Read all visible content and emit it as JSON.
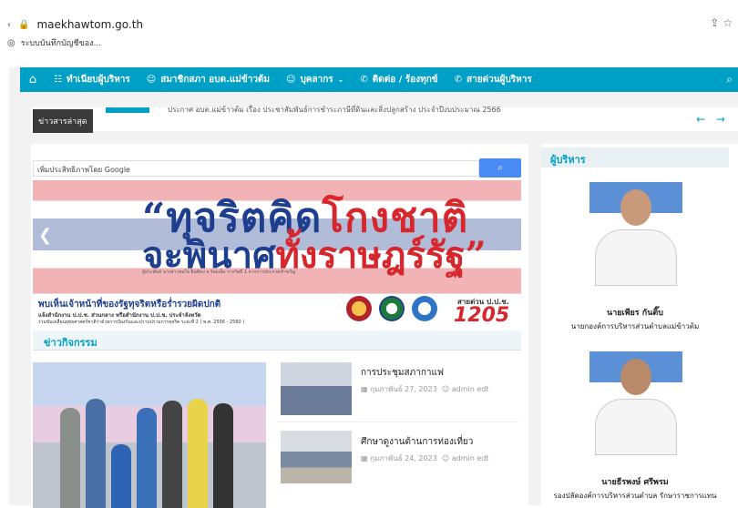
{
  "browser": {
    "url": "maekhawtom.go.th",
    "bookmark": "ระบบบันทึกบัญชีของ..."
  },
  "nav": {
    "items": [
      {
        "label": "ทำเนียบผู้บริหาร",
        "icon": "sitemap-icon"
      },
      {
        "label": "สมาชิกสภา อบต.แม่ข้าวต้ม",
        "icon": "user-icon"
      },
      {
        "label": "บุคลากร",
        "icon": "user-icon",
        "has_dropdown": true
      },
      {
        "label": "ติดต่อ / ร้องทุกข์",
        "icon": "phone-icon"
      },
      {
        "label": "สายด่วนผู้บริหาร",
        "icon": "phone-icon"
      }
    ]
  },
  "ticker": {
    "label": "ข่าวสารล่าสุด",
    "text": "ประกาศ อบต.แม่ข้าวต้ม เรื่อง ประชาสัมพันธ์การชำระภาษีที่ดินและสิ่งปลูกสร้าง ประจำปีงบประมาณ 2566"
  },
  "search": {
    "placeholder": "เพิ่มประสิทธิภาพโดย Google"
  },
  "banner": {
    "line1_a": "“ทุจริตคิด",
    "line1_b": "โกงชาติ",
    "line2_a": "จะพินาศ",
    "line2_b": "ทั้งราษฎร์รัฐ”",
    "credit": "ผู้ประพันธ์ นางสาวสมใจ ยินดีคง จ.ร้อยเอ็ด\nรางวัลที่ 1 จากการประกวดคำขวัญ",
    "report_line1": "พบเห็นเจ้าหน้าที่ของรัฐทุจริตหรือร่ำรวยผิดปกติ",
    "report_line2": "แจ้งสำนักงาน ป.ป.ช. ส่วนกลาง หรือสำนักงาน ป.ป.ช. ประจำจังหวัด",
    "report_line3": "ร่วมขับเคลื่อนยุทธศาสตร์ชาติว่าด้วยการป้องกันและปราบปรามการทุจริต ระยะที่ 2 ( พ.ศ. 2556 - 2560 )",
    "hotline_label": "สายด่วน ป.ป.ช.",
    "hotline_number": "1205"
  },
  "news": {
    "header": "ข่าวกิจกรรม",
    "posts": [
      {
        "title": "การประชุมสภากาแฟ",
        "date": "กุมภาพันธ์ 27, 2023",
        "author": "admin edt"
      },
      {
        "title": "ศึกษาดูงานด้านการท่องเที่ยว",
        "date": "กุมภาพันธ์ 24, 2023",
        "author": "admin edt"
      }
    ]
  },
  "sidebar": {
    "header": "ผู้บริหาร",
    "people": [
      {
        "name": "นายเพียร กันติ๊บ",
        "position": "นายกองค์การบริหารส่วนตำบลแม่ข้าวต้ม"
      },
      {
        "name": "นายธีรพงษ์ ศรีพรม",
        "position": "รองปลัดองค์การบริหารส่วนตำบล รักษาราชการแทน"
      }
    ]
  },
  "colors": {
    "accent": "#00a0c6",
    "ticker_label_bg": "#3a3a3a",
    "google_button": "#4a8af4",
    "flag_red": "#d7262c",
    "flag_blue": "#1e3f8f"
  }
}
